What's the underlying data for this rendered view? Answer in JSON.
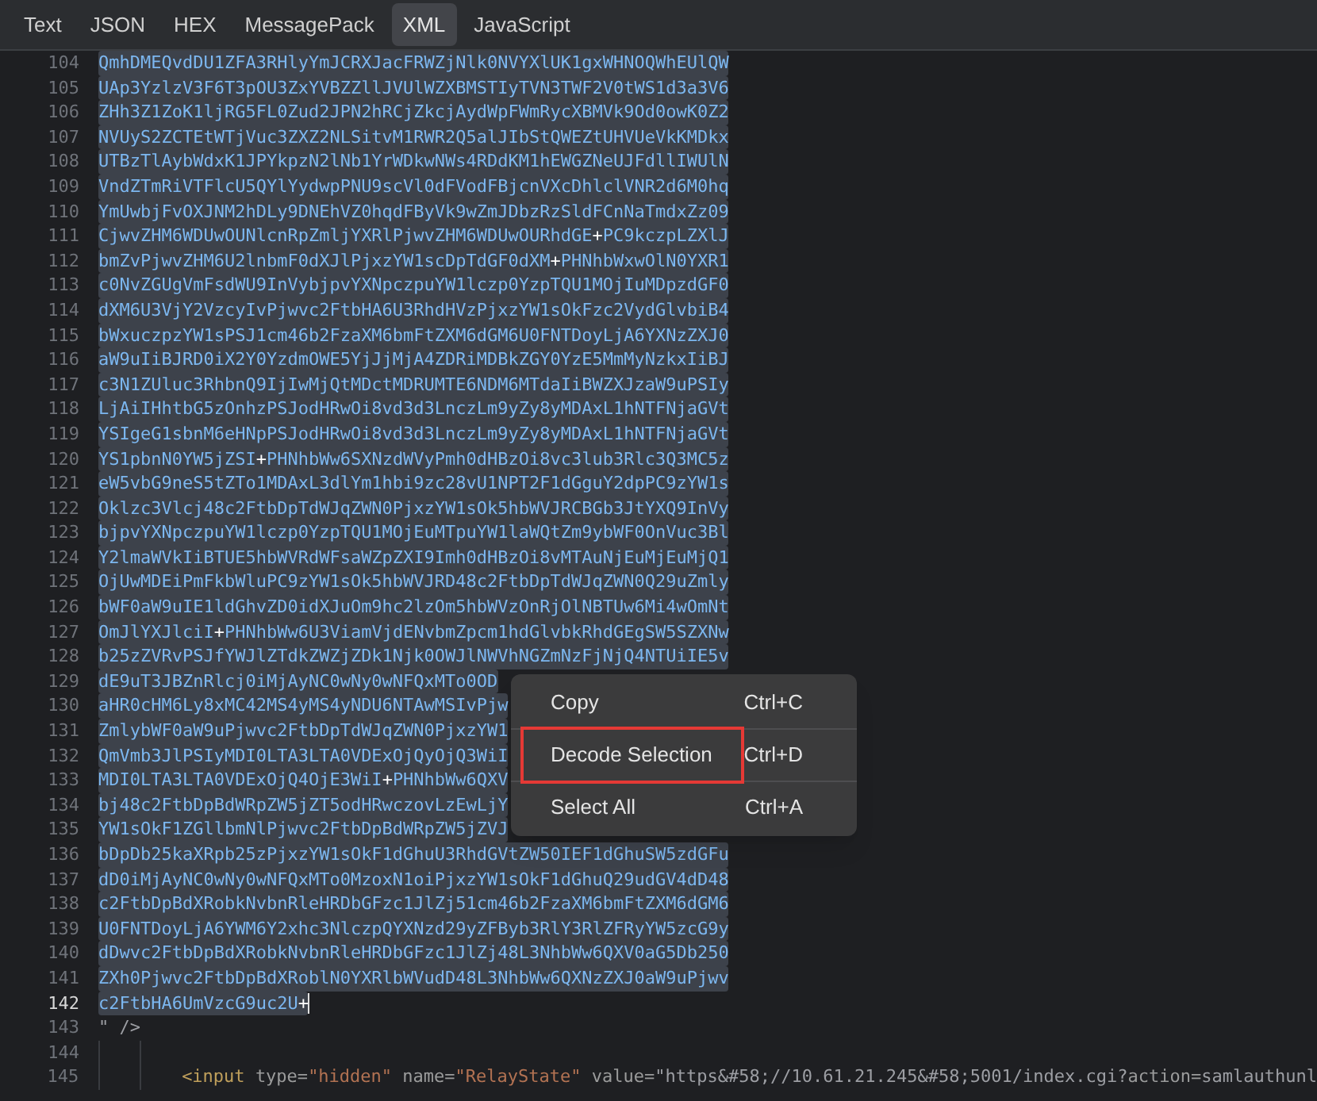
{
  "tabs": [
    {
      "label": "Text",
      "selected": false
    },
    {
      "label": "JSON",
      "selected": false
    },
    {
      "label": "HEX",
      "selected": false
    },
    {
      "label": "MessagePack",
      "selected": false
    },
    {
      "label": "XML",
      "selected": true
    },
    {
      "label": "JavaScript",
      "selected": false
    }
  ],
  "editor": {
    "lines": [
      {
        "number": "104",
        "kind": "base64",
        "selected": true,
        "current": false,
        "text": "QmhDMEQvdDU1ZFA3RHlyYmJCRXJacFRWZjNlk0NVYXlUK1gxWHNOQWhEUlQW"
      },
      {
        "number": "105",
        "kind": "base64",
        "selected": true,
        "current": false,
        "text": "UAp3YzlzV3F6T3pOU3ZxYVBZZllJVUlWZXBMSTIyTVN3TWF2V0tWS1d3a3V6"
      },
      {
        "number": "106",
        "kind": "base64",
        "selected": true,
        "current": false,
        "text": "ZHh3Z1ZoK1ljRG5FL0Zud2JPN2hRCjZkcjAydWpFWmRycXBMVk9Od0owK0Z2"
      },
      {
        "number": "107",
        "kind": "base64",
        "selected": true,
        "current": false,
        "text": "NVUyS2ZCTEtWTjVuc3ZXZ2NLSitvM1RWR2Q5alJIbStQWEZtUHVUeVkKMDkx"
      },
      {
        "number": "108",
        "kind": "base64",
        "selected": true,
        "current": false,
        "text": "UTBzTlAybWdxK1JPYkpzN2lNb1YrWDkwNWs4RDdKM1hEWGZNeUJFdllIWUlN"
      },
      {
        "number": "109",
        "kind": "base64",
        "selected": true,
        "current": false,
        "text": "VndZTmRiVTFlcU5QYlYydwpPNU9scVl0dFVodFBjcnVXcDhlclVNR2d6M0hq"
      },
      {
        "number": "110",
        "kind": "base64",
        "selected": true,
        "current": false,
        "text": "YmUwbjFvOXJNM2hDLy9DNEhVZ0hqdFByVk9wZmJDbzRzSldFCnNaTmdxZz09"
      },
      {
        "number": "111",
        "kind": "base64",
        "selected": true,
        "current": false,
        "text": "CjwvZHM6WDUwOUNlcnRpZmljYXRlPjwvZHM6WDUwOURhdGE+PC9kczpLZXlJ"
      },
      {
        "number": "112",
        "kind": "base64",
        "selected": true,
        "current": false,
        "text": "bmZvPjwvZHM6U2lnbmF0dXJlPjxzYW1scDpTdGF0dXM+PHNhbWxwOlN0YXR1"
      },
      {
        "number": "113",
        "kind": "base64",
        "selected": true,
        "current": false,
        "text": "c0NvZGUgVmFsdWU9InVybjpvYXNpczpuYW1lczp0YzpTQU1MOjIuMDpzdGF0"
      },
      {
        "number": "114",
        "kind": "base64",
        "selected": true,
        "current": false,
        "text": "dXM6U3VjY2VzcyIvPjwvc2FtbHA6U3RhdHVzPjxzYW1sOkFzc2VydGlvbiB4"
      },
      {
        "number": "115",
        "kind": "base64",
        "selected": true,
        "current": false,
        "text": "bWxuczpzYW1sPSJ1cm46b2FzaXM6bmFtZXM6dGM6U0FNTDoyLjA6YXNzZXJ0"
      },
      {
        "number": "116",
        "kind": "base64",
        "selected": true,
        "current": false,
        "text": "aW9uIiBJRD0iX2Y0YzdmOWE5YjJjMjA4ZDRiMDBkZGY0YzE5MmMyNzkxIiBJ"
      },
      {
        "number": "117",
        "kind": "base64",
        "selected": true,
        "current": false,
        "text": "c3N1ZUluc3RhbnQ9IjIwMjQtMDctMDRUMTE6NDM6MTdaIiBWZXJzaW9uPSIy"
      },
      {
        "number": "118",
        "kind": "base64",
        "selected": true,
        "current": false,
        "text": "LjAiIHhtbG5zOnhzPSJodHRwOi8vd3d3LnczLm9yZy8yMDAxL1hNTFNjaGVt"
      },
      {
        "number": "119",
        "kind": "base64",
        "selected": true,
        "current": false,
        "text": "YSIgeG1sbnM6eHNpPSJodHRwOi8vd3d3LnczLm9yZy8yMDAxL1hNTFNjaGVt"
      },
      {
        "number": "120",
        "kind": "base64",
        "selected": true,
        "current": false,
        "text": "YS1pbnN0YW5jZSI+PHNhbWw6SXNzdWVyPmh0dHBzOi8vc3lub3Rlc3Q3MC5z"
      },
      {
        "number": "121",
        "kind": "base64",
        "selected": true,
        "current": false,
        "text": "eW5vbG9neS5tZTo1MDAxL3dlYm1hbi9zc28vU1NPT2F1dGguY2dpPC9zYW1s"
      },
      {
        "number": "122",
        "kind": "base64",
        "selected": true,
        "current": false,
        "text": "Oklzc3Vlcj48c2FtbDpTdWJqZWN0PjxzYW1sOk5hbWVJRCBGb3JtYXQ9InVy"
      },
      {
        "number": "123",
        "kind": "base64",
        "selected": true,
        "current": false,
        "text": "bjpvYXNpczpuYW1lczp0YzpTQU1MOjEuMTpuYW1laWQtZm9ybWF0OnVuc3Bl"
      },
      {
        "number": "124",
        "kind": "base64",
        "selected": true,
        "current": false,
        "text": "Y2lmaWVkIiBTUE5hbWVRdWFsaWZpZXI9Imh0dHBzOi8vMTAuNjEuMjEuMjQ1"
      },
      {
        "number": "125",
        "kind": "base64",
        "selected": true,
        "current": false,
        "text": "OjUwMDEiPmFkbWluPC9zYW1sOk5hbWVJRD48c2FtbDpTdWJqZWN0Q29uZmly"
      },
      {
        "number": "126",
        "kind": "base64",
        "selected": true,
        "current": false,
        "text": "bWF0aW9uIE1ldGhvZD0idXJuOm9hc2lzOm5hbWVzOnRjOlNBTUw6Mi4wOmNt"
      },
      {
        "number": "127",
        "kind": "base64",
        "selected": true,
        "current": false,
        "text": "OmJlYXJlciI+PHNhbWw6U3ViamVjdENvbmZpcm1hdGlvbkRhdGEgSW5SZXNw"
      },
      {
        "number": "128",
        "kind": "base64",
        "selected": true,
        "current": false,
        "text": "b25zZVRvPSJfYWJlZTdkZWZjZDk1Njk0OWJlNWVhNGZmNzFjNjQ4NTUiIE5v"
      },
      {
        "number": "129",
        "kind": "base64",
        "selected": true,
        "current": false,
        "text": "dE9uT3JBZnRlcj0iMjAyNC0wNy0wNFQxMTo0OD"
      },
      {
        "number": "130",
        "kind": "base64",
        "selected": true,
        "current": false,
        "text": "aHR0cHM6Ly8xMC42MS4yMS4yNDU6NTAwMSIvPjw"
      },
      {
        "number": "131",
        "kind": "base64",
        "selected": true,
        "current": false,
        "text": "ZmlybWF0aW9uPjwvc2FtbDpTdWJqZWN0PjxzYW1"
      },
      {
        "number": "132",
        "kind": "base64",
        "selected": true,
        "current": false,
        "text": "QmVmb3JlPSIyMDI0LTA3LTA0VDExOjQyOjQ3WiI"
      },
      {
        "number": "133",
        "kind": "base64",
        "selected": true,
        "current": false,
        "text": "MDI0LTA3LTA0VDExOjQ4OjE3WiI+PHNhbWw6QXV"
      },
      {
        "number": "134",
        "kind": "base64",
        "selected": true,
        "current": false,
        "text": "bj48c2FtbDpBdWRpZW5jZT5odHRwczovLzEwLjY"
      },
      {
        "number": "135",
        "kind": "base64",
        "selected": true,
        "current": false,
        "text": "YW1sOkF1ZGllbmNlPjwvc2FtbDpBdWRpZW5jZVJ"
      },
      {
        "number": "136",
        "kind": "base64",
        "selected": true,
        "current": false,
        "text": "bDpDb25kaXRpb25zPjxzYW1sOkF1dGhuU3RhdGVtZW50IEF1dGhuSW5zdGFu"
      },
      {
        "number": "137",
        "kind": "base64",
        "selected": true,
        "current": false,
        "text": "dD0iMjAyNC0wNy0wNFQxMTo0MzoxN1oiPjxzYW1sOkF1dGhuQ29udGV4dD48"
      },
      {
        "number": "138",
        "kind": "base64",
        "selected": true,
        "current": false,
        "text": "c2FtbDpBdXRobkNvbnRleHRDbGFzc1JlZj51cm46b2FzaXM6bmFtZXM6dGM6"
      },
      {
        "number": "139",
        "kind": "base64",
        "selected": true,
        "current": false,
        "text": "U0FNTDoyLjA6YWM6Y2xhc3NlczpQYXNzd29yZFByb3RlY3RlZFRyYW5zcG9y"
      },
      {
        "number": "140",
        "kind": "base64",
        "selected": true,
        "current": false,
        "text": "dDwvc2FtbDpBdXRobkNvbnRleHRDbGFzc1JlZj48L3NhbWw6QXV0aG5Db250"
      },
      {
        "number": "141",
        "kind": "base64",
        "selected": true,
        "current": false,
        "text": "ZXh0Pjwvc2FtbDpBdXRoblN0YXRlbWVudD48L3NhbWw6QXNzZXJ0aW9uPjwv"
      },
      {
        "number": "142",
        "kind": "base64",
        "selected": true,
        "current": true,
        "text": "c2FtbHA6UmVzcG9uc2U+"
      },
      {
        "number": "143",
        "kind": "markup",
        "selected": false,
        "current": false,
        "text": "\" />"
      },
      {
        "number": "144",
        "current": false
      },
      {
        "number": "145",
        "kind": "markup",
        "selected": false,
        "current": false,
        "text": "        <input type=\"hidden\" name=\"RelayState\" value=\"https&#58;//10.61.21.245&#58;5001/index.cgi?action=samlauthunl"
      }
    ]
  },
  "context_menu": {
    "items": [
      {
        "label": "Copy",
        "shortcut": "Ctrl+C",
        "outlined": false
      },
      {
        "label": "Decode Selection",
        "shortcut": "Ctrl+D",
        "outlined": true
      },
      {
        "label": "Select All",
        "shortcut": "Ctrl+A",
        "outlined": false
      }
    ]
  }
}
